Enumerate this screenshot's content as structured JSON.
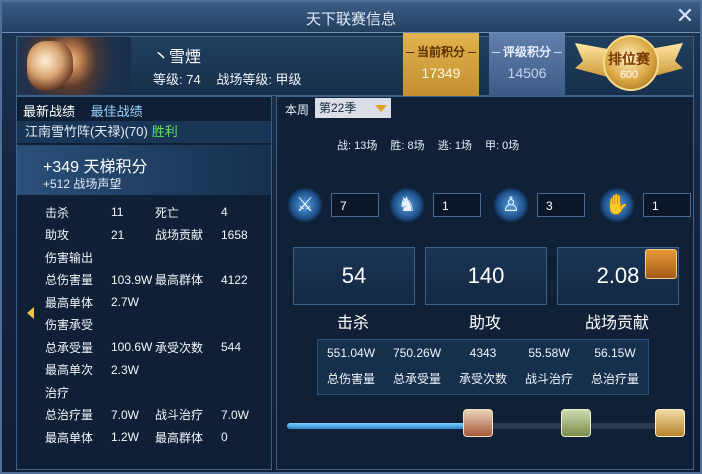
{
  "window": {
    "title": "天下联赛信息"
  },
  "player": {
    "name": "丶雪煙",
    "level_text": "等级: 74",
    "bf_level_text": "战场等级: 甲级"
  },
  "badges": {
    "current": {
      "label": "当前积分",
      "value": "17349"
    },
    "rating": {
      "label": "评级积分",
      "value": "14506"
    },
    "rank": {
      "label": "排位赛",
      "value": "600"
    }
  },
  "left_tabs": {
    "latest": "最新战绩",
    "best": "最佳战绩"
  },
  "opponent": {
    "text": "江南雪竹阵(天禄)(70)",
    "result": "胜利"
  },
  "gain": {
    "ladder": "+349 天梯积分",
    "reputation": "+512 战场声望"
  },
  "stats": {
    "r1": [
      "击杀",
      "11",
      "死亡",
      "4"
    ],
    "r2": [
      "助攻",
      "21",
      "战场贡献",
      "1658"
    ],
    "sec_damage": "伤害输出",
    "r3": [
      "总伤害量",
      "103.9W",
      "最高群体",
      "4122"
    ],
    "r4": [
      "最高单体",
      "2.7W",
      "",
      ""
    ],
    "sec_taken": "伤害承受",
    "r5": [
      "总承受量",
      "100.6W",
      "承受次数",
      "544"
    ],
    "r6": [
      "最高单次",
      "2.3W",
      "",
      ""
    ],
    "sec_heal": "治疗",
    "r7": [
      "总治疗量",
      "7.0W",
      "战斗治疗",
      "7.0W"
    ],
    "r8": [
      "最高单体",
      "1.2W",
      "最高群体",
      "0"
    ]
  },
  "season": {
    "week_label": "本周",
    "selected": "第22季"
  },
  "record": {
    "battles": "战: 13场",
    "wins": "胜: 8场",
    "escapes": "逃: 1场",
    "grade_a": "甲: 0场"
  },
  "counters": {
    "swords": "7",
    "horse": "1",
    "figure": "3",
    "handshake": "1"
  },
  "big": {
    "kills_val": "54",
    "kills_lbl": "击杀",
    "assists_val": "140",
    "assists_lbl": "助攻",
    "contrib_val": "2.08",
    "contrib_lbl": "战场贡献"
  },
  "totals": {
    "values": [
      "551.04W",
      "750.26W",
      "4343",
      "55.58W",
      "56.15W"
    ],
    "labels": [
      "总伤害量",
      "总承受量",
      "承受次数",
      "战斗治疗",
      "总治疗量"
    ]
  },
  "progress": {
    "fraction": 0.46
  }
}
